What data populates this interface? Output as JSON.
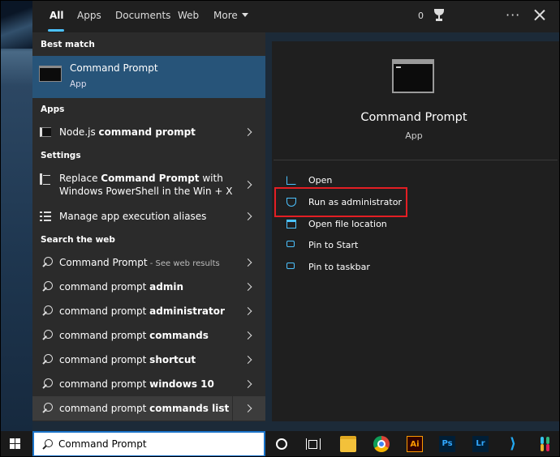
{
  "tabs": [
    {
      "label": "All",
      "active": true
    },
    {
      "label": "Apps"
    },
    {
      "label": "Documents"
    },
    {
      "label": "Web"
    },
    {
      "label": "More"
    }
  ],
  "rewards_count": "0",
  "sections": {
    "best_match": "Best match",
    "apps": "Apps",
    "settings": "Settings",
    "web": "Search the web"
  },
  "best_match": {
    "title": "Command Prompt",
    "subtitle": "App"
  },
  "apps": [
    {
      "pre": "Node.js ",
      "bold": "command prompt",
      "post": ""
    }
  ],
  "settings": [
    {
      "line1_pre": "Replace ",
      "line1_bold": "Command Prompt",
      "line1_post": " with",
      "line2": "Windows PowerShell in the Win + X"
    },
    {
      "label": "Manage app execution aliases"
    }
  ],
  "web_results": [
    {
      "pre": "Command Prompt",
      "bold": "",
      "hint": " - See web results"
    },
    {
      "pre": "command prompt ",
      "bold": "admin",
      "hint": ""
    },
    {
      "pre": "command prompt ",
      "bold": "administrator",
      "hint": ""
    },
    {
      "pre": "command prompt ",
      "bold": "commands",
      "hint": ""
    },
    {
      "pre": "command prompt ",
      "bold": "shortcut",
      "hint": ""
    },
    {
      "pre": "command prompt ",
      "bold": "windows 10",
      "hint": ""
    },
    {
      "pre": "command prompt ",
      "bold": "commands list",
      "hint": ""
    }
  ],
  "preview": {
    "title": "Command Prompt",
    "subtitle": "App",
    "actions": [
      {
        "label": "Open",
        "icon": "open-icon"
      },
      {
        "label": "Run as administrator",
        "icon": "shield-icon"
      },
      {
        "label": "Open file location",
        "icon": "folder-icon"
      },
      {
        "label": "Pin to Start",
        "icon": "pin-icon"
      },
      {
        "label": "Pin to taskbar",
        "icon": "pin-icon"
      }
    ]
  },
  "search": {
    "value": "Command Prompt"
  },
  "taskbar": {
    "ai_label": "Ai",
    "ps_label": "Ps",
    "lr_label": "Lr",
    "vscode_glyph": "⟩"
  },
  "colors": {
    "accent": "#4cc2ff",
    "selection": "#275479",
    "highlight_box": "#e31e24"
  }
}
